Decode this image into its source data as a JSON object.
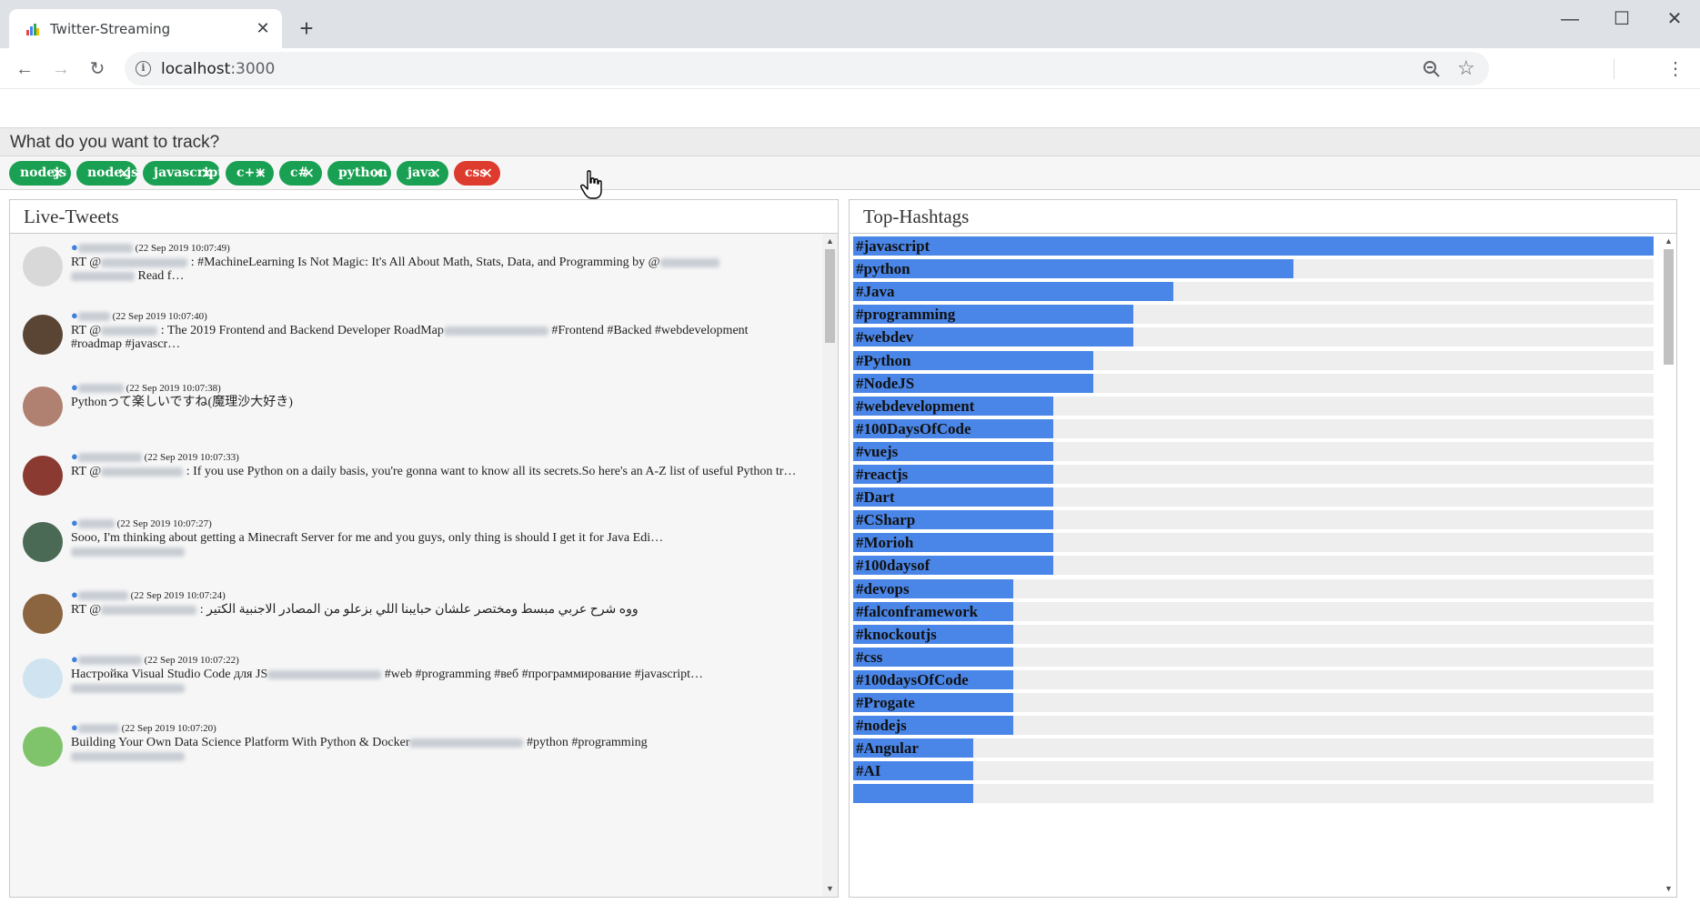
{
  "browser": {
    "tab_title": "Twitter-Streaming",
    "tab_close": "✕",
    "new_tab": "+",
    "url_host": "localhost",
    "url_port": ":3000",
    "window": {
      "minimize": "—",
      "maximize": "☐",
      "close": "✕"
    }
  },
  "tracker": {
    "prompt": "What do you want to track?",
    "chips": [
      {
        "label": "nodejs",
        "color": "#1aa052"
      },
      {
        "label": "node.js",
        "color": "#1aa052"
      },
      {
        "label": "javascript",
        "color": "#1aa052"
      },
      {
        "label": "c++",
        "color": "#1aa052"
      },
      {
        "label": "c#",
        "color": "#1aa052"
      },
      {
        "label": "python",
        "color": "#1aa052"
      },
      {
        "label": "java",
        "color": "#1aa052"
      },
      {
        "label": "css",
        "color": "#dd3b2e"
      }
    ]
  },
  "live_tweets": {
    "title": "Live-Tweets",
    "tweets": [
      {
        "time": "(22 Sep 2019 10:07:49)",
        "text_a": "RT @",
        "text_b": ": #MachineLearning Is Not Magic: It's All About Math, Stats, Data, and Programming by @",
        "line2": "Read f…"
      },
      {
        "time": "(22 Sep 2019 10:07:40)",
        "text_a": "RT @",
        "text_b": ": The 2019 Frontend and Backend Developer RoadMap",
        "text_c": "#Frontend #Backed #webdevelopment",
        "line2": "#roadmap #javascr…"
      },
      {
        "time": "(22 Sep 2019 10:07:38)",
        "text_a": "Pythonって楽しいですね(魔理沙大好き)",
        "text_b": "",
        "line2": ""
      },
      {
        "time": "(22 Sep 2019 10:07:33)",
        "text_a": "RT @",
        "text_b": ": If you use Python on a daily basis, you're gonna want to know all its secrets.So here's an A-Z list of useful Python tr…",
        "line2": ""
      },
      {
        "time": "(22 Sep 2019 10:07:27)",
        "text_a": "Sooo, I'm thinking about getting a Minecraft Server for me and you guys, only thing is should I get it for Java Edi…",
        "text_b": "",
        "line2": ""
      },
      {
        "time": "(22 Sep 2019 10:07:24)",
        "text_a": "RT @",
        "text_b": ": ووه شرح عربي مبسط ومختصر علشان حبايبنا اللي بزعلو من المصادر الاجنبية الكتير",
        "line2": ""
      },
      {
        "time": "(22 Sep 2019 10:07:22)",
        "text_a": "Настройка Visual Studio Code для JS",
        "text_b": "#web #programming #веб #программирование #javascript…",
        "line2": ""
      },
      {
        "time": "(22 Sep 2019 10:07:20)",
        "text_a": "Building Your Own Data Science Platform With Python & Docker",
        "text_b": "#python #programming",
        "line2": ""
      }
    ]
  },
  "top_hashtags": {
    "title": "Top-Hashtags",
    "items": [
      {
        "tag": "#javascript",
        "count": 20
      },
      {
        "tag": "#python",
        "count": 11
      },
      {
        "tag": "#Java",
        "count": 8
      },
      {
        "tag": "#programming",
        "count": 7
      },
      {
        "tag": "#webdev",
        "count": 7
      },
      {
        "tag": "#Python",
        "count": 6
      },
      {
        "tag": "#NodeJS",
        "count": 6
      },
      {
        "tag": "#webdevelopment",
        "count": 5
      },
      {
        "tag": "#100DaysOfCode",
        "count": 5
      },
      {
        "tag": "#vuejs",
        "count": 5
      },
      {
        "tag": "#reactjs",
        "count": 5
      },
      {
        "tag": "#Dart",
        "count": 5
      },
      {
        "tag": "#CSharp",
        "count": 5
      },
      {
        "tag": "#Morioh",
        "count": 5
      },
      {
        "tag": "#100daysof",
        "count": 5
      },
      {
        "tag": "#devops",
        "count": 4
      },
      {
        "tag": "#falconframework",
        "count": 4
      },
      {
        "tag": "#knockoutjs",
        "count": 4
      },
      {
        "tag": "#css",
        "count": 4
      },
      {
        "tag": "#100daysOfCode",
        "count": 4
      },
      {
        "tag": "#Progate",
        "count": 4
      },
      {
        "tag": "#nodejs",
        "count": 4
      },
      {
        "tag": "#Angular",
        "count": 3
      },
      {
        "tag": "#AI",
        "count": 3
      },
      {
        "tag": "",
        "count": 3
      }
    ],
    "max_count": 20,
    "bar_color": "#4a86e8"
  }
}
